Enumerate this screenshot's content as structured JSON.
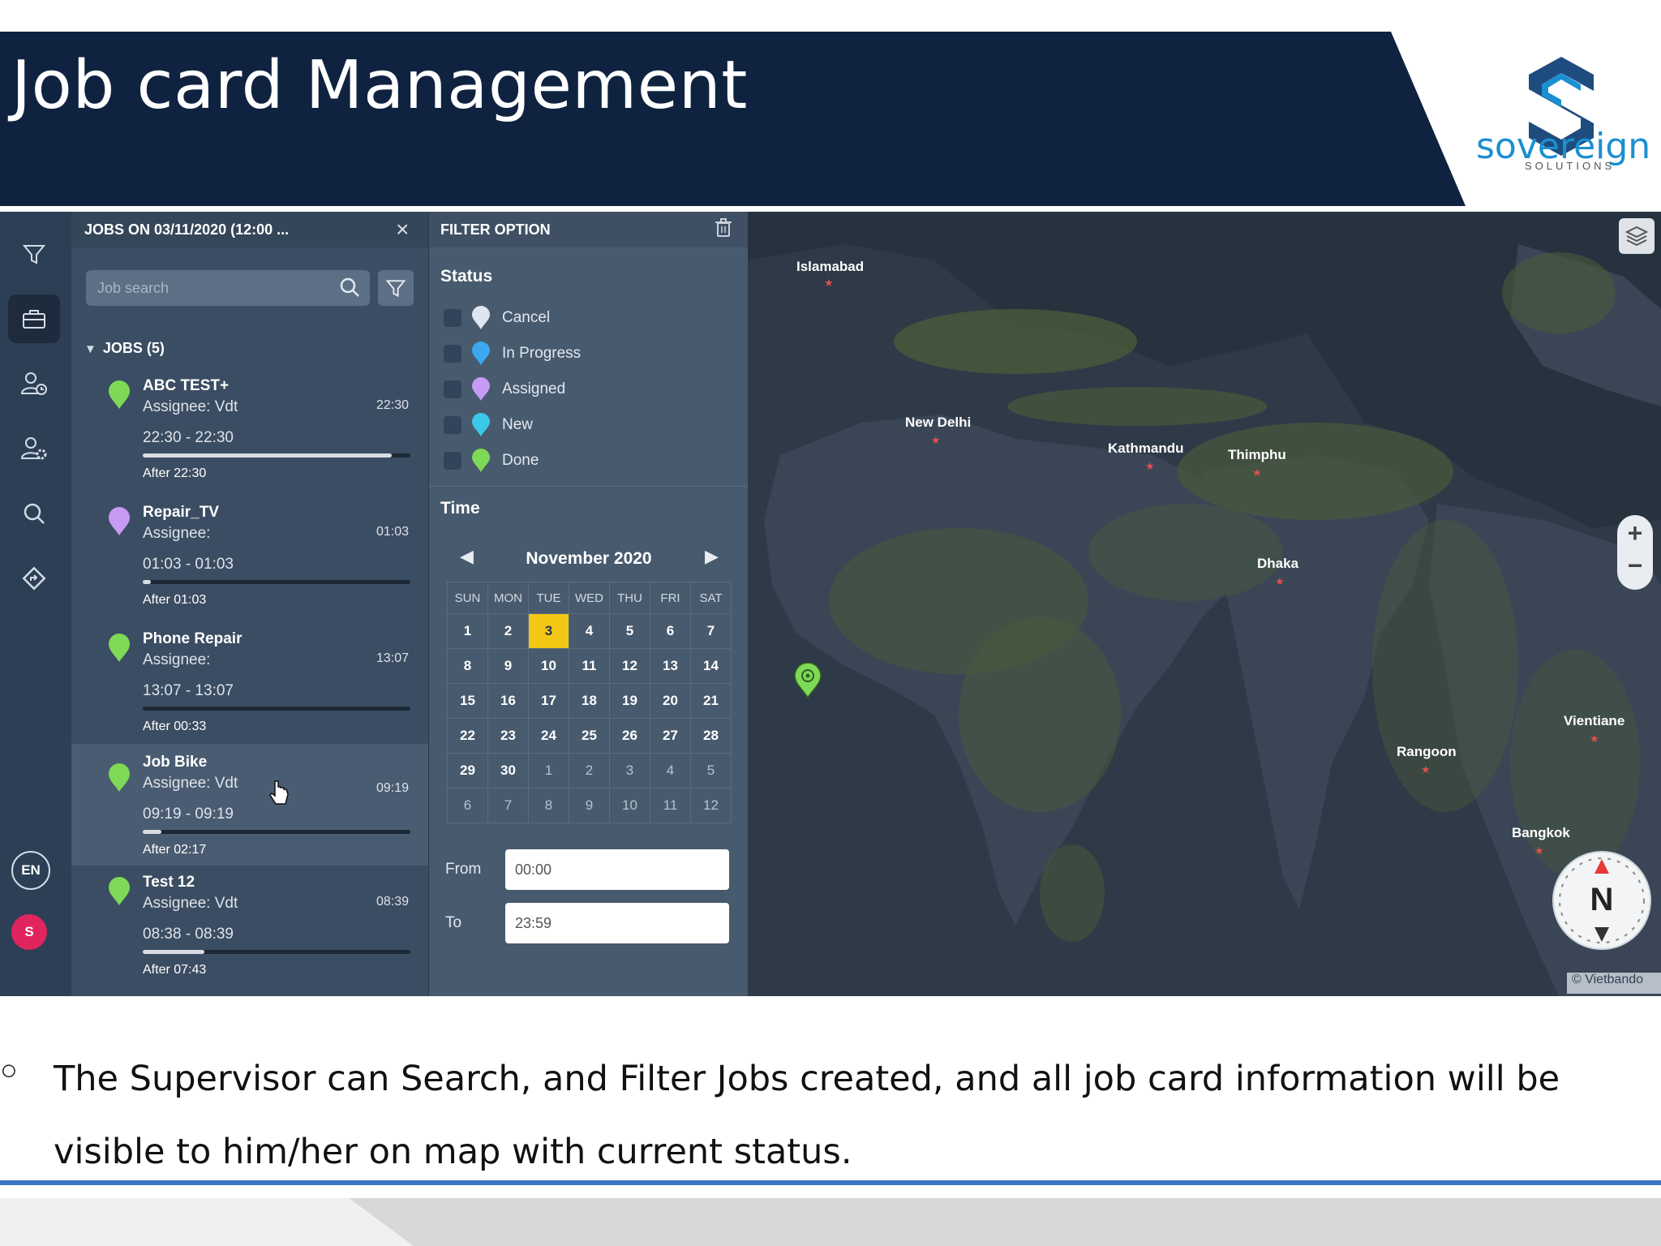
{
  "slide": {
    "title": "Job card Management",
    "logo_word": "sovereign",
    "logo_sub": "SOLUTIONS",
    "caption_bullet": "○",
    "caption": "The Supervisor can Search, and Filter Jobs created, and all job card information will be visible to him/her on map with current status."
  },
  "rail": {
    "language": "EN",
    "user_initial": "S",
    "icons": [
      "filter-icon",
      "briefcase-icon",
      "user-clock-icon",
      "user-settings-icon",
      "search-icon",
      "route-icon"
    ]
  },
  "jobs_panel": {
    "title": "JOBS ON 03/11/2020 (12:00 ...",
    "close": "×",
    "search_placeholder": "Job search",
    "group_label": "JOBS (5)",
    "jobs": [
      {
        "name": "ABC TEST+",
        "assignee": "Assignee: Vdt",
        "time": "22:30",
        "range": "22:30 - 22:30",
        "after": "After 22:30",
        "progress": 0.93,
        "pin_color": "#7ed957"
      },
      {
        "name": "Repair_TV",
        "assignee": "Assignee:",
        "time": "01:03",
        "range": "01:03 - 01:03",
        "after": "After 01:03",
        "progress": 0.03,
        "pin_color": "#c79af4"
      },
      {
        "name": "Phone Repair",
        "assignee": "Assignee:",
        "time": "13:07",
        "range": "13:07 - 13:07",
        "after": "After 00:33",
        "progress": 0.0,
        "pin_color": "#7ed957"
      },
      {
        "name": "Job Bike",
        "assignee": "Assignee: Vdt",
        "time": "09:19",
        "range": "09:19 - 09:19",
        "after": "After 02:17",
        "progress": 0.07,
        "pin_color": "#7ed957"
      },
      {
        "name": "Test 12",
        "assignee": "Assignee: Vdt",
        "time": "08:39",
        "range": "08:38 - 08:39",
        "after": "After 07:43",
        "progress": 0.23,
        "pin_color": "#7ed957"
      }
    ]
  },
  "filter_panel": {
    "title": "FILTER OPTION",
    "status_label": "Status",
    "statuses": [
      {
        "label": "Cancel",
        "color": "#dfe6ef"
      },
      {
        "label": "In Progress",
        "color": "#3ba8f0"
      },
      {
        "label": "Assigned",
        "color": "#c79af4"
      },
      {
        "label": "New",
        "color": "#3cc8e8"
      },
      {
        "label": "Done",
        "color": "#7ed957"
      }
    ],
    "time_label": "Time",
    "month": "November 2020",
    "weekdays": [
      "SUN",
      "MON",
      "TUE",
      "WED",
      "THU",
      "FRI",
      "SAT"
    ],
    "weeks": [
      [
        "1",
        "2",
        "3",
        "4",
        "5",
        "6",
        "7"
      ],
      [
        "8",
        "9",
        "10",
        "11",
        "12",
        "13",
        "14"
      ],
      [
        "15",
        "16",
        "17",
        "18",
        "19",
        "20",
        "21"
      ],
      [
        "22",
        "23",
        "24",
        "25",
        "26",
        "27",
        "28"
      ],
      [
        "29",
        "30",
        "1",
        "2",
        "3",
        "4",
        "5"
      ],
      [
        "6",
        "7",
        "8",
        "9",
        "10",
        "11",
        "12"
      ]
    ],
    "selected_day": "3",
    "from_label": "From",
    "from_value": "00:00",
    "to_label": "To",
    "to_value": "23:59"
  },
  "map": {
    "cities": [
      "Islamabad",
      "New Delhi",
      "Kathmandu",
      "Thimphu",
      "Dhaka",
      "Rangoon",
      "Vientiane",
      "Bangkok"
    ],
    "compass": "N",
    "attribution": "© Vietbando",
    "zoom_in": "+",
    "zoom_out": "−",
    "land_color": "#4a5a3a",
    "water_color": "#27323f"
  },
  "colors": {
    "header": "#0f2340",
    "accent": "#3a76c4",
    "today": "#f3c814"
  }
}
